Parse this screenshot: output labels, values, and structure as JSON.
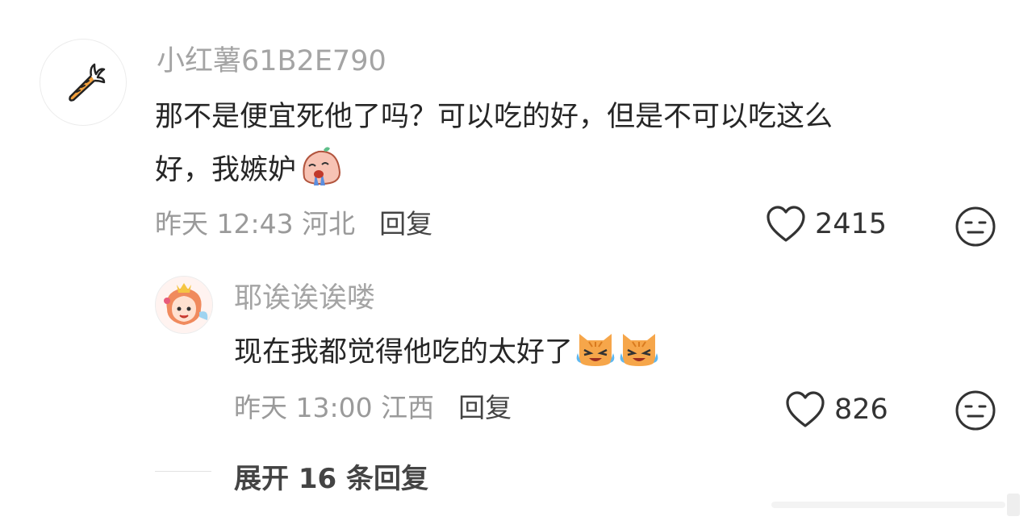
{
  "comment": {
    "avatar_icon": "carrot-icon",
    "username": "小红薯61B2E790",
    "text_line1": "那不是便宜死他了吗？可以吃的好，但是不可以吃这么",
    "text_line2": "好，我嫉妒",
    "emoji": "crying-emoji",
    "meta": "昨天 12:43 河北",
    "reply_label": "回复",
    "likes": "2415",
    "like_icon": "heart-icon",
    "reaction_icon": "neutral-face-icon"
  },
  "reply": {
    "avatar_icon": "cartoon-girl-avatar",
    "username": "耶诶诶诶喽",
    "text": "现在我都觉得他吃的太好了",
    "emojis": [
      "crying-cat-emoji",
      "crying-cat-emoji"
    ],
    "meta": "昨天 13:00 江西",
    "reply_label": "回复",
    "likes": "826",
    "like_icon": "heart-icon",
    "reaction_icon": "neutral-face-icon"
  },
  "expand": {
    "label": "展开 16 条回复"
  },
  "colors": {
    "username": "#a4a4a4",
    "text": "#262626",
    "meta": "#9a9a9a"
  }
}
